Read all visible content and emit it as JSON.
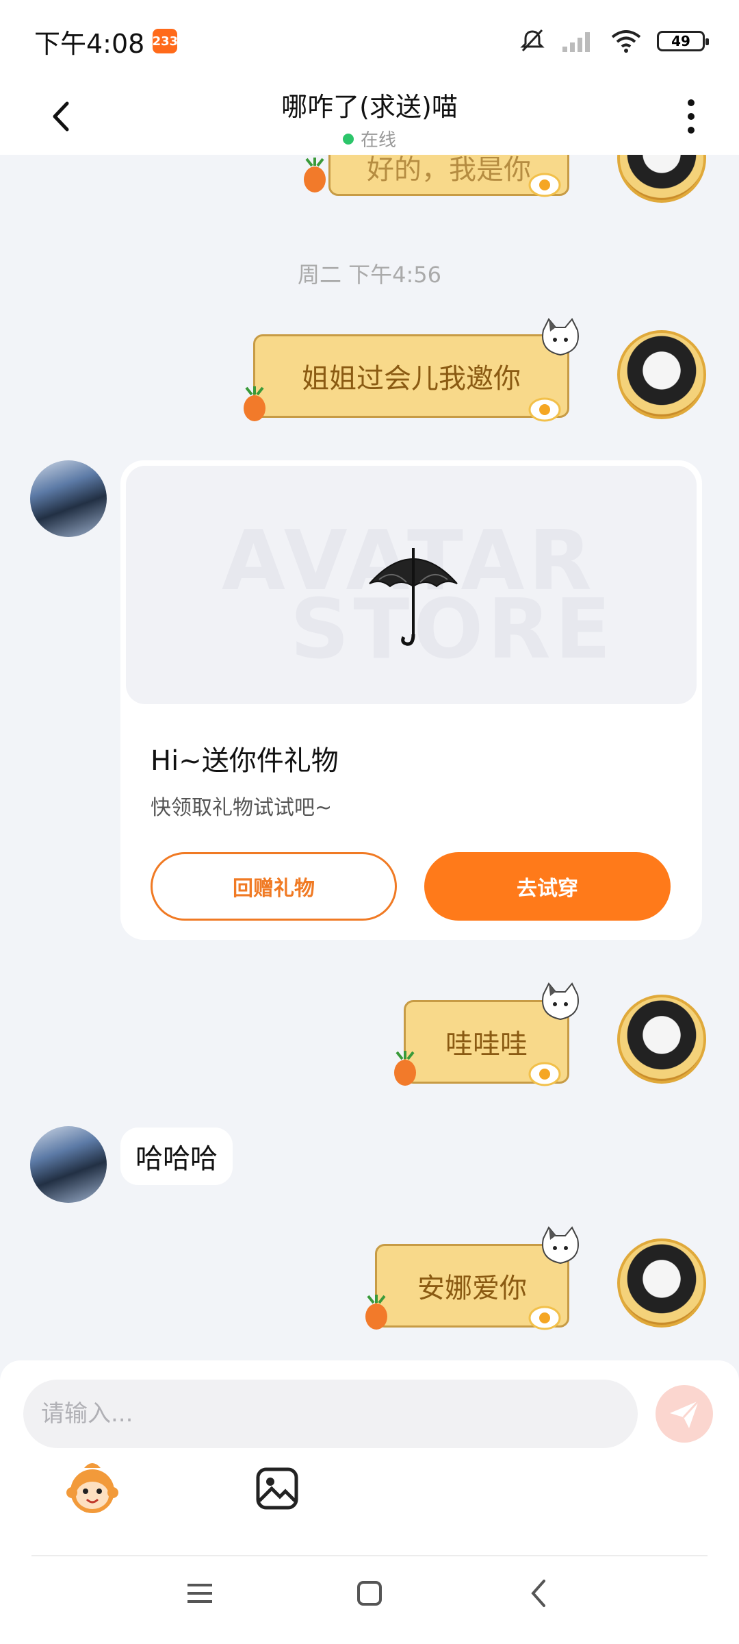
{
  "status_bar": {
    "time": "下午4:08",
    "badge": "233",
    "battery": "49"
  },
  "header": {
    "title": "哪咋了(求送)喵",
    "status": "在线"
  },
  "chat": {
    "partial_top_text": "好的，我是你",
    "timestamp": "周二 下午4:56",
    "messages": [
      {
        "from": "self",
        "text": "姐姐过会儿我邀你"
      },
      {
        "from": "other",
        "type": "gift_card"
      },
      {
        "from": "self",
        "text": "哇哇哇"
      },
      {
        "from": "other",
        "text": "哈哈哈"
      },
      {
        "from": "self",
        "text": "安娜爱你"
      }
    ],
    "gift_card": {
      "watermark_top": "AVATAR",
      "watermark_bottom": "STORE",
      "title": "Hi~送你件礼物",
      "subtitle": "快领取礼物试试吧~",
      "return_gift_label": "回赠礼物",
      "try_on_label": "去试穿"
    }
  },
  "input": {
    "placeholder": "请输入..."
  },
  "colors": {
    "accent": "#ff7a1a",
    "online": "#2cc56a",
    "bubble_fill": "#f8d98a",
    "bubble_border": "#c79b45"
  },
  "icons": [
    "back-icon",
    "more-icon",
    "send-icon",
    "emoji-mascot-icon",
    "image-icon",
    "menu-icon",
    "home-icon",
    "nav-back-icon",
    "mute-icon",
    "signal-icon",
    "wifi-icon",
    "battery-icon"
  ]
}
